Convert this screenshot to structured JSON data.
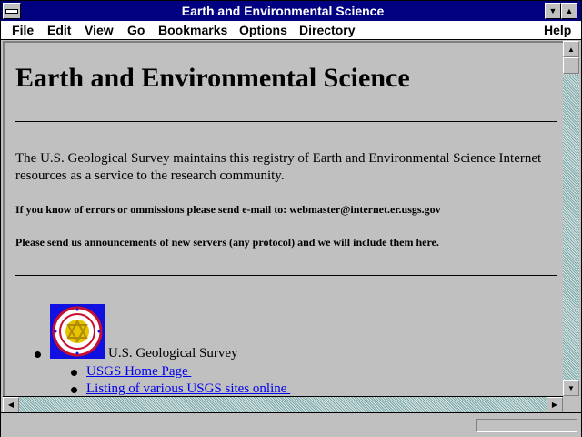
{
  "window": {
    "title": "Earth and Environmental Science"
  },
  "menubar": {
    "items": [
      {
        "label": "File"
      },
      {
        "label": "Edit"
      },
      {
        "label": "View"
      },
      {
        "label": "Go"
      },
      {
        "label": "Bookmarks"
      },
      {
        "label": "Options"
      },
      {
        "label": "Directory"
      },
      {
        "label": "Help"
      }
    ]
  },
  "page": {
    "heading": "Earth and Environmental Science",
    "intro": "The U.S. Geological Survey maintains this registry of Earth and Environmental Science Internet resources as a service to the research community.",
    "note_errors": "If you know of errors or ommissions please send e-mail to: webmaster@internet.er.usgs.gov",
    "note_announce": "Please send us announcements of new servers (any protocol) and we will include them here.",
    "list": {
      "item_label": "U.S. Geological Survey",
      "logo_icon": "usgs-seal-icon",
      "links": [
        {
          "label": "USGS Home Page "
        },
        {
          "label": "Listing of various USGS sites online "
        }
      ]
    }
  },
  "colors": {
    "titlebar": "#000080",
    "link": "#0000ee",
    "logo_bg": "#1010e0"
  }
}
